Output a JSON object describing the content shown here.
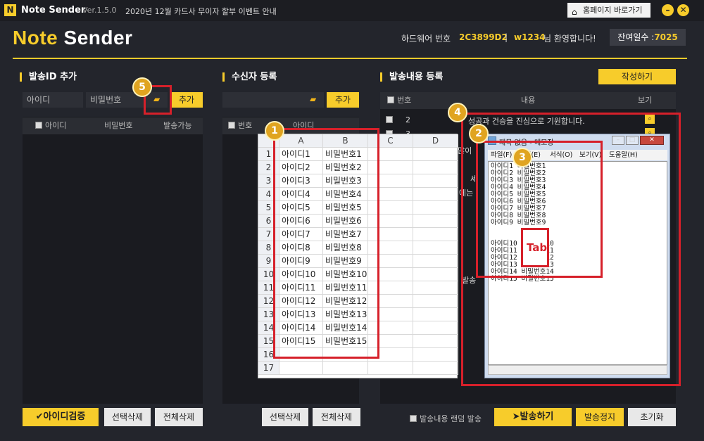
{
  "titlebar": {
    "app": "Note Sender",
    "version": "Ver.1.5.0",
    "notice": "2020년 12월 카드사 무이자 할부 이벤트 안내",
    "home_label": "홈페이지 바로가기",
    "logo_letter": "N"
  },
  "header": {
    "brand_a": "Note",
    "brand_b": "Sender",
    "hw_label": "하드웨어 번호",
    "hw_value": "2C3899D2",
    "sep": "|",
    "user": "w1234",
    "welcome": "님 환영합니다!",
    "days_label": "잔여일수 :",
    "days_value": "7025"
  },
  "left": {
    "title": "발송ID 추가",
    "id_placeholder": "아이디",
    "pw_placeholder": "비밀번호",
    "add_label": "추가",
    "cols": [
      "아이디",
      "비밀번호",
      "발송가능"
    ],
    "verify_label": "✔아이디검증",
    "del_sel": "선택삭제",
    "del_all": "전체삭제"
  },
  "middle": {
    "title": "수신자 등록",
    "add_label": "추가",
    "cols": [
      "번호",
      "아이디"
    ],
    "del_sel": "선택삭제",
    "del_all": "전체삭제"
  },
  "right": {
    "title": "발송내용 등록",
    "write_label": "작성하기",
    "cols": [
      "번호",
      "내용",
      "보기"
    ],
    "rows": [
      {
        "num": "2",
        "text": "성공과 건승을 진심으로 기원합니다."
      },
      {
        "num": "3",
        "text": ""
      }
    ],
    "fragments": [
      "많이",
      "세",
      "에는",
      "발송"
    ],
    "random_label": "발송내용 랜덤 발송",
    "send_label": "발송하기",
    "stop_label": "발송정지",
    "reset_label": "초기화"
  },
  "sheet": {
    "cols": [
      "A",
      "B",
      "C",
      "D"
    ],
    "rows": [
      [
        "1",
        "아이디1",
        "비밀번호1"
      ],
      [
        "2",
        "아이디2",
        "비밀번호2"
      ],
      [
        "3",
        "아이디3",
        "비밀번호3"
      ],
      [
        "4",
        "아이디4",
        "비밀번호4"
      ],
      [
        "5",
        "아이디5",
        "비밀번호5"
      ],
      [
        "6",
        "아이디6",
        "비밀번호6"
      ],
      [
        "7",
        "아이디7",
        "비밀번호7"
      ],
      [
        "8",
        "아이디8",
        "비밀번호8"
      ],
      [
        "9",
        "아이디9",
        "비밀번호9"
      ],
      [
        "10",
        "아이디10",
        "비밀번호10"
      ],
      [
        "11",
        "아이디11",
        "비밀번호11"
      ],
      [
        "12",
        "아이디12",
        "비밀번호12"
      ],
      [
        "13",
        "아이디13",
        "비밀번호13"
      ],
      [
        "14",
        "아이디14",
        "비밀번호14"
      ],
      [
        "15",
        "아이디15",
        "비밀번호15"
      ],
      [
        "16",
        "",
        ""
      ],
      [
        "17",
        "",
        ""
      ]
    ]
  },
  "notepad": {
    "title": "제목 없음 - 메모장",
    "menu": [
      "파일(F)",
      "편집(E)",
      "서식(O)",
      "보기(V)",
      "도움말(H)"
    ],
    "lines": [
      "아이디1 비밀번호1",
      "아이디2 비밀번호2",
      "아이디3 비밀번호3",
      "아이디4 비밀번호4",
      "아이디5 비밀번호5",
      "아이디6 비밀번호6",
      "아이디7 비밀번호7",
      "아이디8 비밀번호8",
      "아이디9 비밀번호9",
      "아이디10 비밀번호10",
      "아이디11 비밀번호11",
      "아이디12 비밀번호12",
      "아이디13 비밀번호13",
      "아이디14 비밀번호14",
      "아이디15 비밀번호15"
    ],
    "tab_label": "Tab"
  },
  "badges": [
    "1",
    "2",
    "3",
    "4",
    "5"
  ],
  "colors": {
    "accent": "#f7cc2b",
    "highlight": "#d6202a",
    "background": "#23252c"
  }
}
